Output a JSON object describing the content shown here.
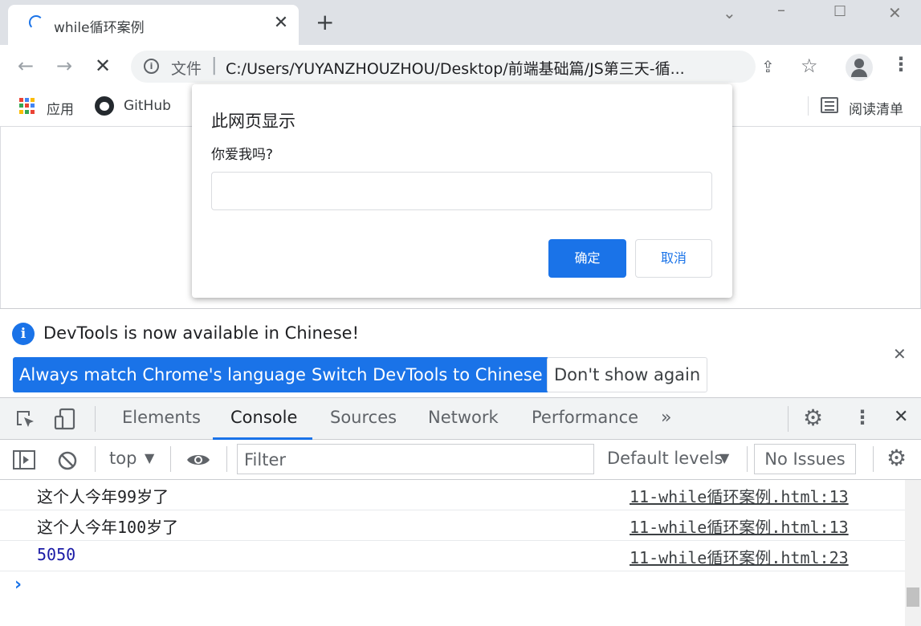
{
  "browser": {
    "tab_title": "while循环案例",
    "tab_close": "✕",
    "new_tab": "+",
    "url_label": "文件",
    "url": "C:/Users/YUYANZHOUZHOU/Desktop/前端基础篇/JS第三天-循...",
    "bookmarks": [
      {
        "label": "应用"
      },
      {
        "label": "GitHub"
      }
    ],
    "reading_list": "阅读清单"
  },
  "dialog": {
    "title": "此网页显示",
    "message": "你爱我吗?",
    "input_value": "",
    "ok_label": "确定",
    "cancel_label": "取消"
  },
  "infobar": {
    "message": "DevTools is now available in Chinese!",
    "btn_match": "Always match Chrome's language",
    "btn_switch": "Switch DevTools to Chinese",
    "btn_dismiss": "Don't show again"
  },
  "devtools": {
    "tabs": [
      "Elements",
      "Console",
      "Sources",
      "Network",
      "Performance"
    ],
    "more": "»",
    "context": "top",
    "filter_placeholder": "Filter",
    "levels": "Default levels",
    "issues": "No Issues",
    "logs": [
      {
        "message": "这个人今年99岁了",
        "source": "11-while循环案例.html:13"
      },
      {
        "message": "这个人今年100岁了",
        "source": "11-while循环案例.html:13"
      },
      {
        "message": "5050",
        "source": "11-while循环案例.html:23"
      }
    ]
  },
  "colors": {
    "accent": "#1a73e8",
    "number": "#1a1aa6"
  }
}
